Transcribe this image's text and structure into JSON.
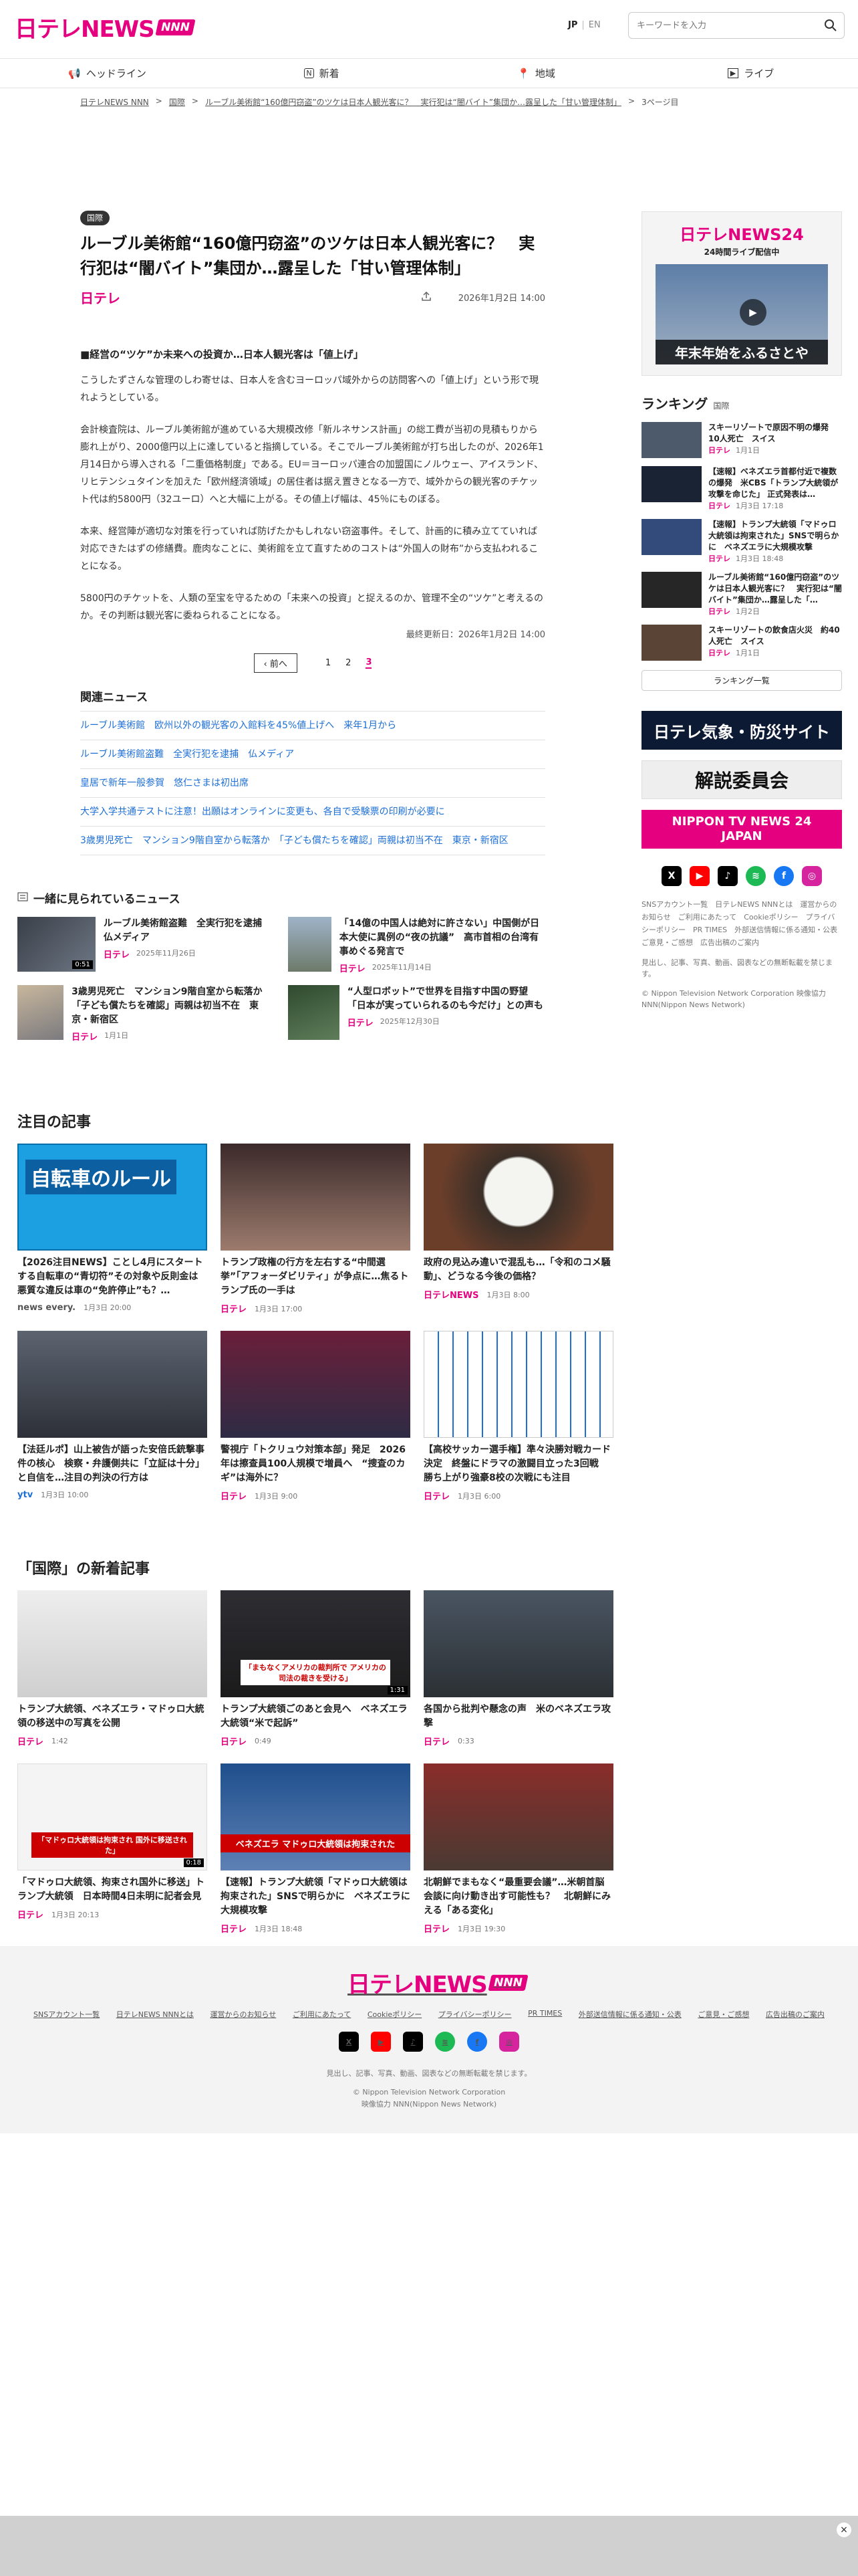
{
  "header": {
    "logo_text": "日テレNEWS",
    "logo_badge": "NNN",
    "lang_jp": "JP",
    "lang_en": "EN",
    "search_placeholder": "キーワードを入力"
  },
  "nav": [
    {
      "label": "ヘッドライン",
      "icon": "megaphone-icon"
    },
    {
      "label": "新着",
      "icon": "new-icon"
    },
    {
      "label": "地域",
      "icon": "map-pin-icon"
    },
    {
      "label": "ライブ",
      "icon": "live-icon"
    }
  ],
  "breadcrumb": [
    "日テレNEWS NNN",
    "国際",
    "ルーブル美術館“160億円窃盗”のツケは日本人観光客に？　実行犯は“闇バイト”集団か…露呈した「甘い管理体制」",
    "3ページ目"
  ],
  "article": {
    "category": "国際",
    "title": "ルーブル美術館“160億円窃盗”のツケは日本人観光客に？　実行犯は“闇バイト”集団か…露呈した「甘い管理体制」",
    "brand": "日テレ",
    "date": "2026年1月2日 14:00",
    "heading": "■経営の“ツケ”か未来への投資か…日本人観光客は「値上げ」",
    "paragraphs": [
      "こうしたずさんな管理のしわ寄せは、日本人を含むヨーロッパ域外からの訪問客への「値上げ」という形で現れようとしている。",
      "会計検査院は、ルーブル美術館が進めている大規模改修「新ルネサンス計画」の総工費が当初の見積もりから膨れ上がり、2000億円以上に達していると指摘している。そこでルーブル美術館が打ち出したのが、2026年1月14日から導入される「二重価格制度」である。EU＝ヨーロッパ連合の加盟国にノルウェー、アイスランド、リヒテンシュタインを加えた「欧州経済領域」の居住者は据え置きとなる一方で、域外からの観光客のチケット代は約5800円（32ユーロ）へと大幅に上がる。その値上げ幅は、45％にものぼる。",
      "本来、経営陣が適切な対策を行っていれば防げたかもしれない窃盗事件。そして、計画的に積み立てていれば対応できたはずの修繕費。鹿肉なことに、美術館を立て直すためのコストは“外国人の財布”から支払われることになる。",
      "5800円のチケットを、人類の至宝を守るための「未来への投資」と捉えるのか、管理不全の“ツケ”と考えるのか。その判断は観光客に委ねられることになる。"
    ],
    "updated": "最終更新日：2026年1月2日 14:00"
  },
  "pagination": {
    "prev": "前へ",
    "pages": [
      "1",
      "2",
      "3"
    ],
    "current": "3"
  },
  "related": {
    "title": "関連ニュース",
    "items": [
      "ルーブル美術館　欧州以外の観光客の入館料を45%値上げへ　来年1月から",
      "ルーブル美術館盗難　全実行犯を逮捕　仏メディア",
      "皇居で新年一般参賀　悠仁さまは初出席",
      "大学入学共通テストに注意！出願はオンラインに変更も、各自で受験票の印刷が必要に",
      "3歳男児死亡　マンション9階自室から転落か　「子ども償たちを確認」両親は初当不在　東京・新宿区"
    ]
  },
  "watched": {
    "title": "一緒に見られているニュース",
    "items": [
      {
        "title": "ルーブル美術館盗難　全実行犯を逮捕　仏メディア",
        "brand": "日テレ",
        "date": "2025年11月26日",
        "time": "0:51"
      },
      {
        "title": "「14億の中国人は絶対に許さない」中国側が日本大使に異例の“夜の抗議”　高市首相の台湾有事めぐる発言で",
        "brand": "日テレ",
        "date": "2025年11月14日",
        "time": ""
      },
      {
        "title": "3歳男児死亡　マンション9階自室から転落か　「子ども償たちを確認」両親は初当不在　東京・新宿区",
        "brand": "日テレ",
        "date": "1月1日",
        "time": ""
      },
      {
        "title": "“人型ロボット”で世界を目指す中国の野望「日本が実っていられるのも今だけ」との声も",
        "brand": "日テレ",
        "date": "2025年12月30日",
        "time": ""
      }
    ]
  },
  "featured": {
    "title": "注目の記事",
    "items": [
      {
        "title": "【2026注目NEWS】ことし4月にスタートする自転車の“青切符”その対象や反則金は　悪質な違反は車の“免許停止”も？…",
        "brand": "news every.",
        "date": "1月3日 20:00",
        "label": "自転車のルール"
      },
      {
        "title": "トランプ政権の行方を左右する“中間選挙”「アフォーダビリティ」が争点に…焦るトランプ氏の一手は",
        "brand": "日テレ",
        "date": "1月3日 17:00",
        "label": ""
      },
      {
        "title": "政府の見込み違いで混乱も…「令和のコメ騒動」、どうなる今後の価格？",
        "brand": "日テレNEWS",
        "date": "1月3日 8:00",
        "label": ""
      },
      {
        "title": "【法廷ルポ】山上被告が語った安倍氏銃撃事件の核心　検察・弁護側共に「立証は十分」と自信を…注目の判決の行方は",
        "brand": "ytv",
        "date": "1月3日 10:00",
        "label": ""
      },
      {
        "title": "警視庁「トクリュウ対策本部」発足　2026年は擦查員100人規模で増員へ　“捜査のカギ”は海外に？",
        "brand": "日テレ",
        "date": "1月3日 9:00",
        "label": ""
      },
      {
        "title": "【高校サッカー選手権】準々決勝対戦カード決定　終盤にドラマの激闘目立った3回戦　勝ち上がり強豪8校の次戦にも注目",
        "brand": "日テレ",
        "date": "1月3日 6:00",
        "label": ""
      }
    ]
  },
  "intl": {
    "title": "「国際」の新着記事",
    "items": [
      {
        "title": "トランプ大統領、ベネズエラ・マドゥロ大統領の移送中の写真を公開",
        "brand": "日テレ",
        "date": "1:42",
        "time": "",
        "cap": ""
      },
      {
        "title": "トランプ大統領ごのあと会見へ　ベネズエラ大統領“米で起訴”",
        "brand": "日テレ",
        "date": "0:49",
        "time": "1:31",
        "cap": "「まもなくアメリカの裁判所で アメリカの司法の裁きを受ける」"
      },
      {
        "title": "各国から批判や懸念の声　米のベネズエラ攻撃",
        "brand": "日テレ",
        "date": "0:33",
        "time": "",
        "cap": ""
      },
      {
        "title": "「マドゥロ大統領、拘束され国外に移送」トランプ大統領　日本時間4日未明に記者会見",
        "brand": "日テレ",
        "date": "1月3日 20:13",
        "time": "0:18",
        "cap": "「マドゥロ大統領は拘束され 国外に移送された」"
      },
      {
        "title": "【速報】トランプ大統領「マドゥロ大統領は拘束された」SNSで明らかに　ベネズエラに大規模攻撃",
        "brand": "日テレ",
        "date": "1月3日 18:48",
        "time": "",
        "cap": "ベネズエラ マドゥロ大統領は拘束された"
      },
      {
        "title": "北朝鮮でまもなく“最重要会議”…米朝首脳会談に向け動き出す可能性も？　北朝鮮にみえる「ある変化」",
        "brand": "日テレ",
        "date": "1月3日 19:30",
        "time": "",
        "cap": ""
      }
    ]
  },
  "sidebar": {
    "live_logo": "日テレNEWS24",
    "live_sub": "24時間ライブ配信中",
    "live_caption": "年末年始をふるさとや",
    "ranking_title": "ランキング",
    "ranking_cat": "国際",
    "ranking": [
      {
        "title": "スキーリゾートで原因不明の爆発 10人死亡　スイス",
        "date": "1月1日"
      },
      {
        "title": "【速報】ベネズエラ首都付近で複数の爆発　米CBS「トランプ大統領が攻撃を命じた」 正式発表は…",
        "date": "1月3日 17:18"
      },
      {
        "title": "【速報】トランプ大統領「マドゥロ大統領は拘束された」SNSで明らかに　ベネズエラに大規模攻撃",
        "date": "1月3日 18:48"
      },
      {
        "title": "ルーブル美術館“160億円窃盗”のツケは日本人観光客に？　実行犯は“闇バイト”集団か…露呈した「…",
        "date": "1月2日"
      },
      {
        "title": "スキーリゾートの飲食店火災　約40人死亡　スイス",
        "date": "1月1日"
      }
    ],
    "ranking_more": "ランキング一覧",
    "banner1": "日テレ気象・防災サイト",
    "banner2": "解説委員会",
    "banner3": "NIPPON TV NEWS 24 JAPAN",
    "links": "SNSアカウント一覧　日テレNEWS NNNとは　運営からのお知らせ　ご利用にあたって　Cookieポリシー　プライバシーポリシー　PR TIMES　外部送信情報に係る通知・公表　ご意見・ご感想　広告出稿のご案内",
    "notice": "見出し、記事、写真、動画、図表などの無断転載を禁じます。",
    "copy": "© Nippon Television Network Corporation 映像協力 NNN(Nippon News Network)"
  },
  "footer": {
    "links": [
      "SNSアカウント一覧",
      "日テレNEWS NNNとは",
      "運営からのお知らせ",
      "ご利用にあたって",
      "Cookieポリシー",
      "プライバシーポリシー",
      "PR TIMES",
      "外部送信情報に係る通知・公表",
      "ご意見・ご感想",
      "広告出稿のご案内"
    ],
    "notice": "見出し、記事、写真、動画、図表などの無断転載を禁じます。",
    "copy1": "© Nippon Television Network Corporation",
    "copy2": "映像協力 NNN(Nippon News Network)"
  },
  "colors": {
    "brand": "#e4007f",
    "link": "#1d6fd6"
  }
}
